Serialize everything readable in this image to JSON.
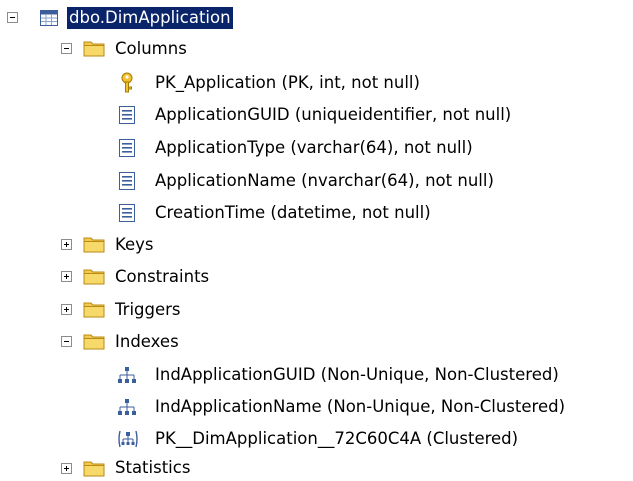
{
  "tree": {
    "root": {
      "label": "dbo.DimApplication",
      "icon": "table-icon",
      "expanded": true
    },
    "columns_folder": {
      "label": "Columns",
      "icon": "folder-icon",
      "expanded": true,
      "items": [
        {
          "label": "PK_Application (PK, int, not null)",
          "icon": "key-icon"
        },
        {
          "label": "ApplicationGUID (uniqueidentifier, not null)",
          "icon": "column-icon"
        },
        {
          "label": "ApplicationType (varchar(64), not null)",
          "icon": "column-icon"
        },
        {
          "label": "ApplicationName (nvarchar(64), not null)",
          "icon": "column-icon"
        },
        {
          "label": "CreationTime (datetime, not null)",
          "icon": "column-icon"
        }
      ]
    },
    "keys_folder": {
      "label": "Keys",
      "icon": "folder-icon",
      "expanded": false
    },
    "constraints_folder": {
      "label": "Constraints",
      "icon": "folder-icon",
      "expanded": false
    },
    "triggers_folder": {
      "label": "Triggers",
      "icon": "folder-icon",
      "expanded": false
    },
    "indexes_folder": {
      "label": "Indexes",
      "icon": "folder-icon",
      "expanded": true,
      "items": [
        {
          "label": "IndApplicationGUID (Non-Unique, Non-Clustered)",
          "icon": "index-icon"
        },
        {
          "label": "IndApplicationName (Non-Unique, Non-Clustered)",
          "icon": "index-icon"
        },
        {
          "label": "PK__DimApplication__72C60C4A (Clustered)",
          "icon": "clustered-index-icon"
        }
      ]
    },
    "statistics_folder": {
      "label": "Statistics",
      "icon": "folder-icon",
      "expanded": false
    }
  },
  "colors": {
    "selection": "#0a246a",
    "folder": "#f2c94c"
  }
}
